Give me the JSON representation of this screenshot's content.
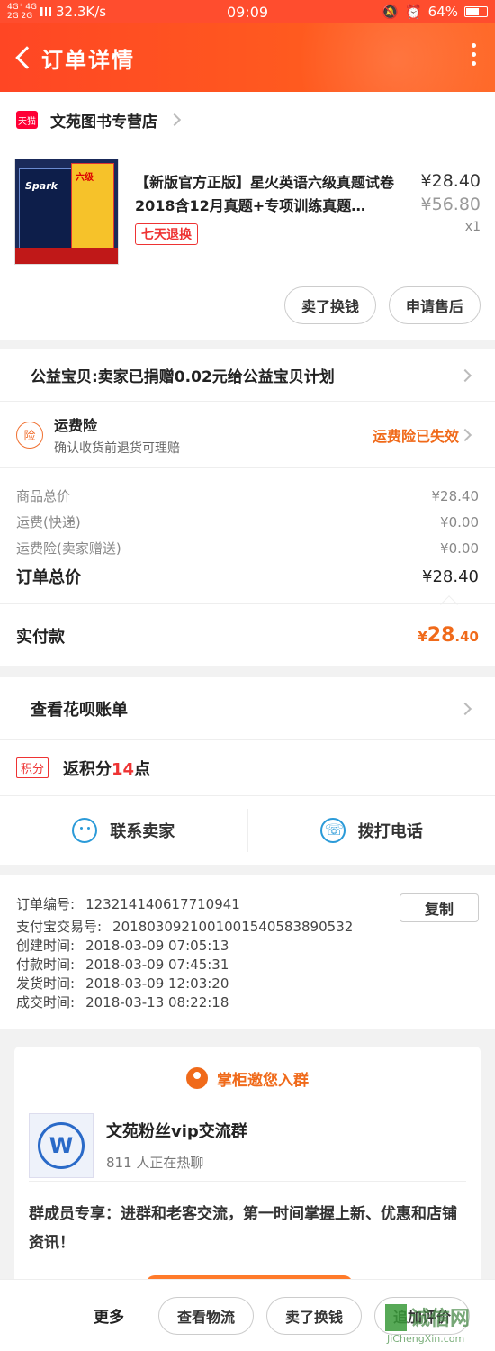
{
  "status_bar": {
    "network_top": "4G⁺ 4G",
    "network_bottom": "2G 2G",
    "speed": "32.3K/s",
    "time": "09:09",
    "battery": "64%"
  },
  "header": {
    "title": "订单详情"
  },
  "store": {
    "badge": "天猫",
    "name": "文苑图书专营店"
  },
  "product": {
    "thumb_text_left": "Spark",
    "thumb_text_right": "六级",
    "title": "【新版官方正版】星火英语六级真题试卷2018含12月真题+专项训练真题…",
    "return_badge": "七天退换",
    "price": "¥28.40",
    "original_price": "¥56.80",
    "quantity": "x1"
  },
  "actions": {
    "sell": "卖了换钱",
    "after_sale": "申请售后"
  },
  "charity": {
    "text": "公益宝贝:卖家已捐赠0.02元给公益宝贝计划"
  },
  "insurance": {
    "icon": "险",
    "title": "运费险",
    "subtitle": "确认收货前退货可理赔",
    "status": "运费险已失效"
  },
  "summary": {
    "rows": [
      {
        "label": "商品总价",
        "value": "¥28.40"
      },
      {
        "label": "运费(快递)",
        "value": "¥0.00"
      },
      {
        "label": "运费险(卖家赠送)",
        "value": "¥0.00"
      }
    ],
    "total_label": "订单总价",
    "total_value": "¥28.40",
    "paid_label": "实付款",
    "paid_currency": "¥",
    "paid_int": "28",
    "paid_dec": ".40"
  },
  "huabei": {
    "text": "查看花呗账单"
  },
  "points": {
    "badge": "积分",
    "prefix": "返积分",
    "num": "14",
    "suffix": "点"
  },
  "contact": {
    "seller": "联系卖家",
    "phone": "拨打电话"
  },
  "order_info": {
    "copy": "复制",
    "rows": [
      {
        "k": "订单编号:",
        "v": "123214140617710941"
      },
      {
        "k": "支付宝交易号:",
        "v": "2018030921001001540583890532"
      },
      {
        "k": "创建时间:",
        "v": "2018-03-09 07:05:13"
      },
      {
        "k": "付款时间:",
        "v": "2018-03-09 07:45:31"
      },
      {
        "k": "发货时间:",
        "v": "2018-03-09 12:03:20"
      },
      {
        "k": "成交时间:",
        "v": "2018-03-13 08:22:18"
      }
    ]
  },
  "group": {
    "heading": "掌柜邀您入群",
    "logo_letter": "W",
    "name": "文苑粉丝vip交流群",
    "count": "811 人正在热聊",
    "desc": "群成员专享：进群和老客交流，第一时间掌握上新、优惠和店铺资讯！"
  },
  "bottom": {
    "more": "更多",
    "logistics": "查看物流",
    "sell": "卖了换钱",
    "review": "追加评价"
  },
  "watermark": {
    "text": "诚信网",
    "sub": "JiChengXin.com"
  }
}
